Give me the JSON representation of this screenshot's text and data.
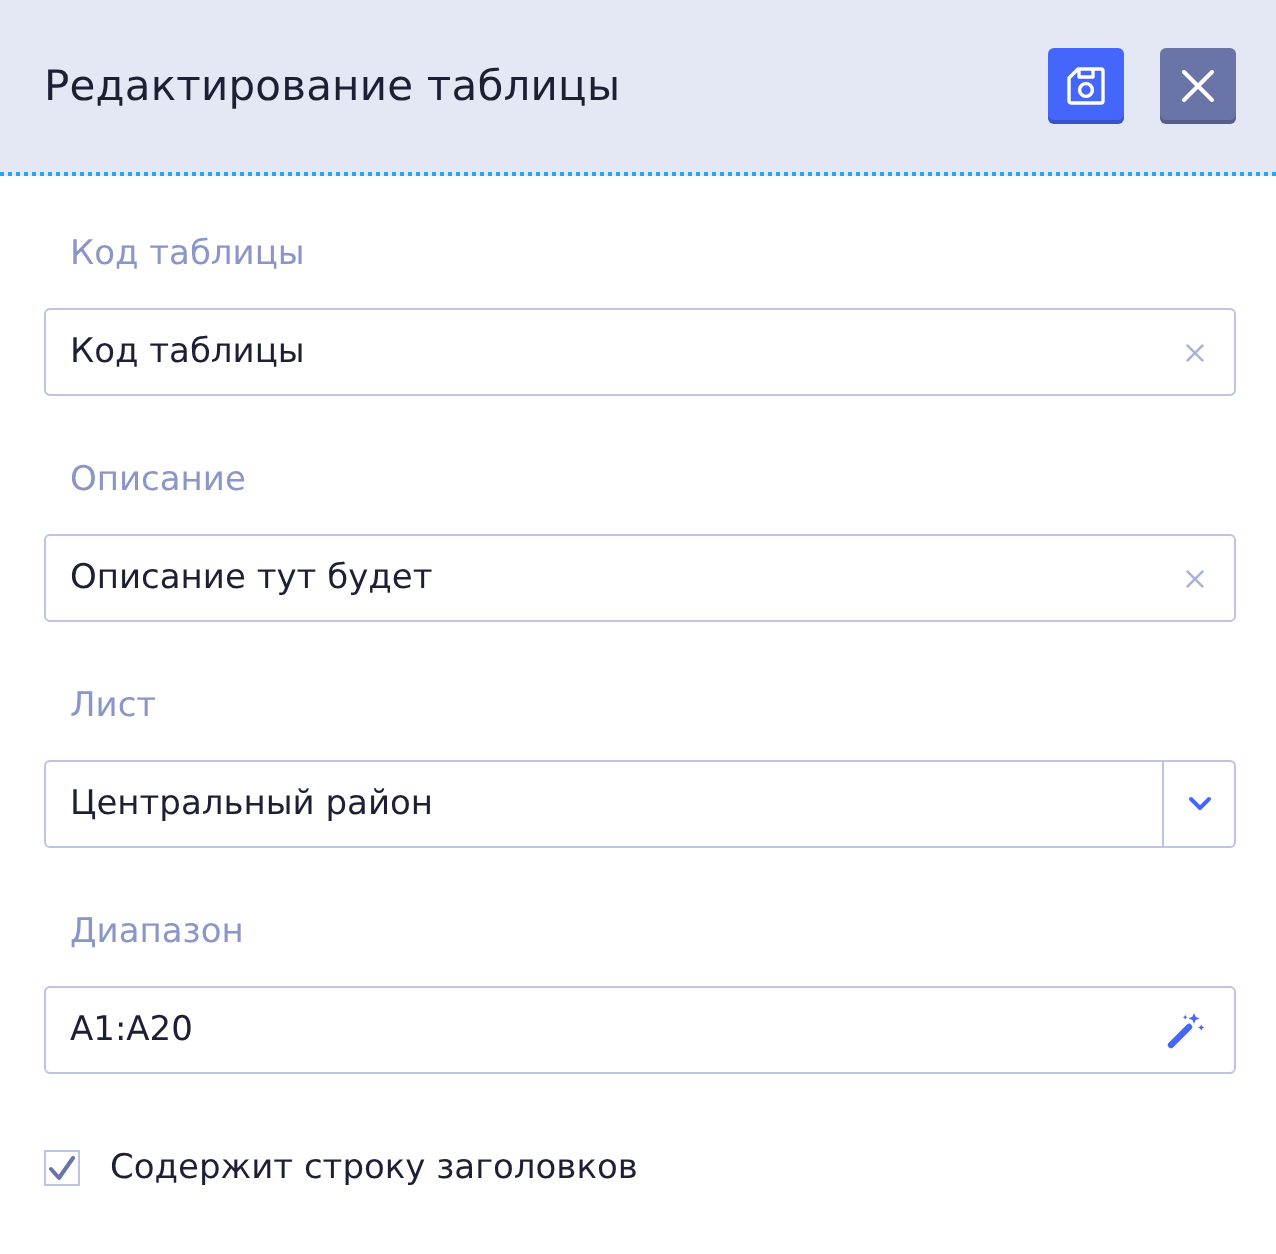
{
  "window": {
    "title": "Редактирование таблицы"
  },
  "fields": [
    {
      "kind": "text",
      "label": "Код таблицы",
      "value": "Код таблицы"
    },
    {
      "kind": "text",
      "label": "Описание",
      "value": "Описание тут будет"
    },
    {
      "kind": "select",
      "label": "Лист",
      "value": "Центральный район"
    },
    {
      "kind": "range",
      "label": "Диапазон",
      "value": "A1:A20"
    }
  ],
  "checkbox": {
    "label": "Содержит строку заголовков",
    "checked": true
  }
}
